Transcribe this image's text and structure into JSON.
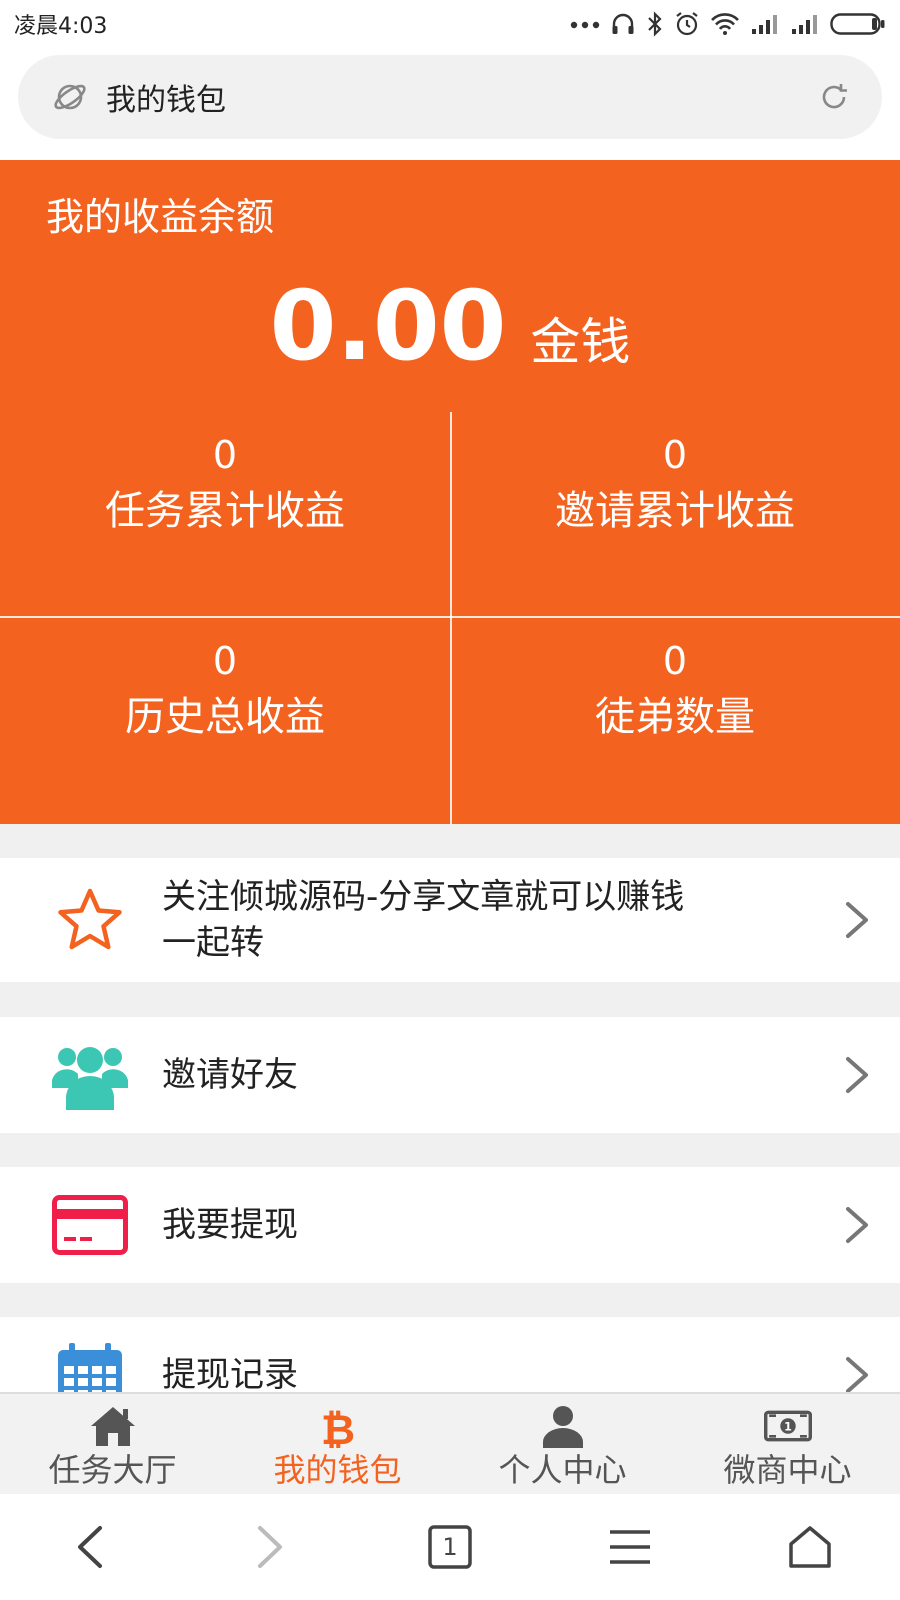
{
  "status_bar": {
    "time": "凌晨4:03",
    "icons": [
      "more-dots-icon",
      "headset-icon",
      "bluetooth-icon",
      "alarm-icon",
      "wifi-icon",
      "signal-icon",
      "signal-icon",
      "battery-icon"
    ]
  },
  "address_bar": {
    "title": "我的钱包",
    "left_icon": "planet-icon",
    "right_icon": "reload-icon"
  },
  "balance": {
    "title": "我的收益余额",
    "value": "0.00",
    "unit": "金钱"
  },
  "stats": [
    {
      "value": "0",
      "label": "任务累计收益"
    },
    {
      "value": "0",
      "label": "邀请累计收益"
    },
    {
      "value": "0",
      "label": "历史总收益"
    },
    {
      "value": "0",
      "label": "徒弟数量"
    }
  ],
  "menu": [
    {
      "label": "关注倾城源码-分享文章就可以赚钱一起转",
      "icon": "star-outline-icon",
      "color": "#f4621f"
    },
    {
      "label": "邀请好友",
      "icon": "users-group-icon",
      "color": "#3cc7b4"
    },
    {
      "label": "我要提现",
      "icon": "credit-card-icon",
      "color": "#ef1f4a"
    },
    {
      "label": "提现记录",
      "icon": "calendar-icon",
      "color": "#3a8fd8"
    }
  ],
  "tabs": [
    {
      "label": "任务大厅",
      "icon": "home-icon",
      "active": false
    },
    {
      "label": "我的钱包",
      "icon": "bitcoin-icon",
      "active": true
    },
    {
      "label": "个人中心",
      "icon": "user-icon",
      "active": false
    },
    {
      "label": "微商中心",
      "icon": "banknote-icon",
      "active": false
    }
  ],
  "nav": {
    "tab_count": "1",
    "buttons": [
      "back-icon",
      "forward-icon",
      "tabs-icon",
      "menu-icon",
      "home-outline-icon"
    ]
  },
  "colors": {
    "accent": "#f4621f",
    "tab_inactive": "#555555"
  }
}
